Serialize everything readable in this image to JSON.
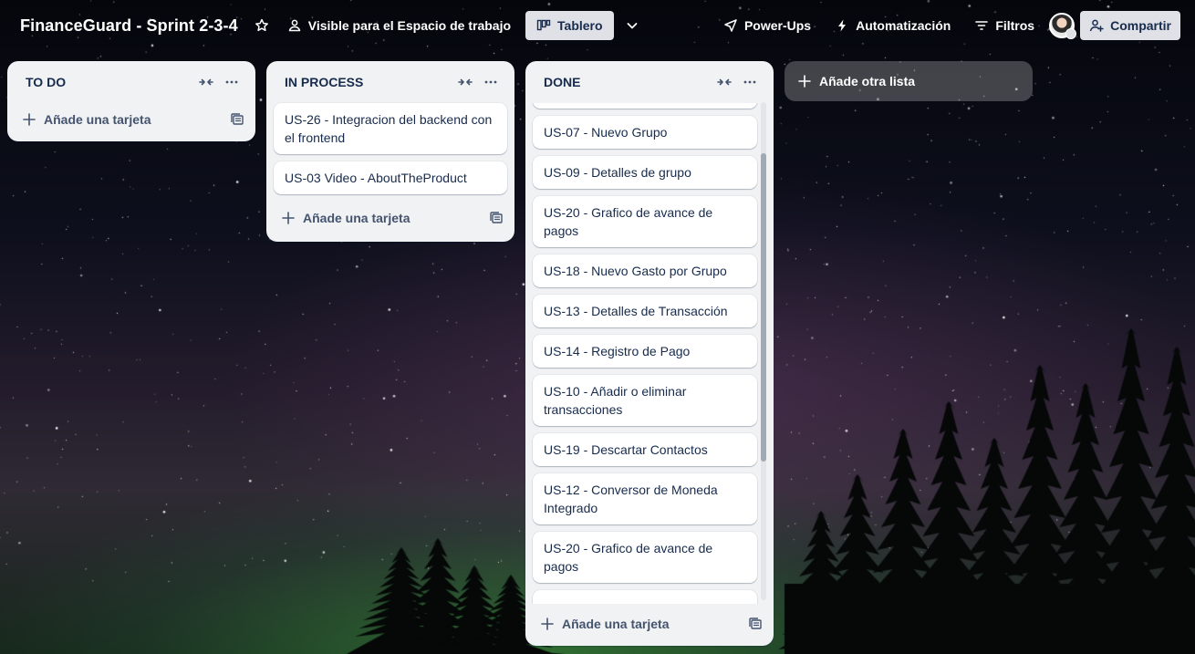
{
  "header": {
    "board_title": "FinanceGuard - Sprint 2-3-4",
    "visibility_label": "Visible para el Espacio de trabajo",
    "view_label": "Tablero",
    "powerups_label": "Power-Ups",
    "automation_label": "Automatización",
    "filters_label": "Filtros",
    "share_label": "Compartir"
  },
  "lists": {
    "todo": {
      "title": "TO DO",
      "add_card_label": "Añade una tarjeta"
    },
    "inprocess": {
      "title": "IN PROCESS",
      "cards": [
        "US-26 - Integracion del backend con el frontend",
        "US-03 Video - AboutTheProduct"
      ],
      "add_card_label": "Añade una tarjeta"
    },
    "done": {
      "title": "DONE",
      "cards": [
        "",
        "US-07 - Nuevo Grupo",
        "US-09 - Detalles de grupo",
        "US-20 - Grafico de avance de pagos",
        "US-18 - Nuevo Gasto por Grupo",
        "US-13 - Detalles de Transacción",
        "US-14 - Registro de Pago",
        "US-10 - Añadir o eliminar transacciones",
        "US-19 - Descartar Contactos",
        "US-12 - Conversor de Moneda Integrado",
        "US-20 - Grafico de avance de pagos",
        ""
      ],
      "add_card_label": "Añade una tarjeta"
    }
  },
  "add_list_label": "Añade otra lista",
  "icons": {
    "star": "star-icon",
    "visibility": "people-icon",
    "board": "board-icon",
    "chevron": "chevron-down-icon",
    "powerups": "rocket-icon",
    "automation": "lightning-icon",
    "filters": "filter-icon",
    "share": "add-user-icon",
    "collapse": "collapse-icon",
    "more": "more-icon",
    "plus": "plus-icon",
    "template": "template-icon"
  }
}
